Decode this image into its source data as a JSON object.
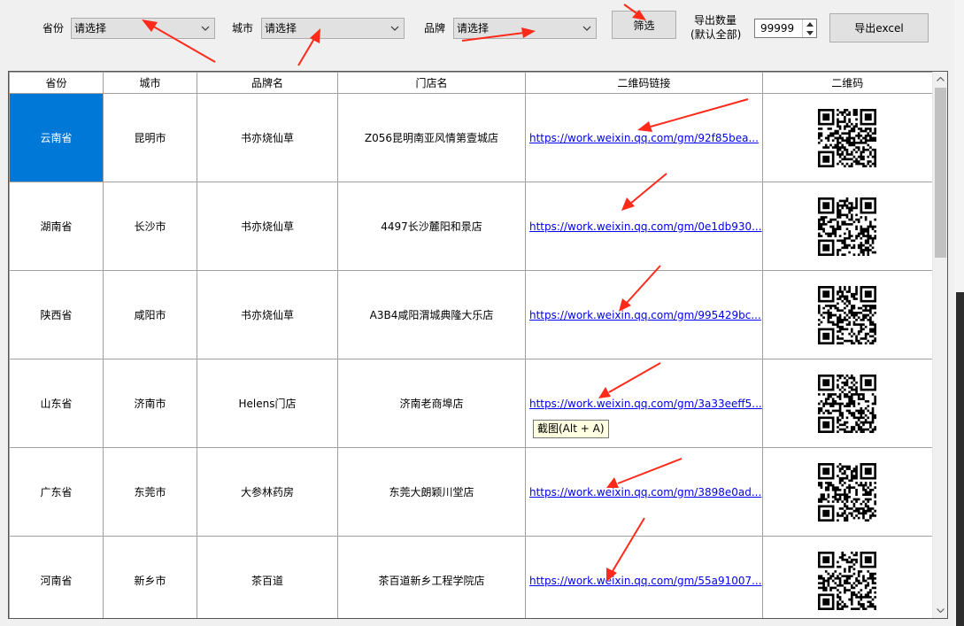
{
  "filters": {
    "province_label": "省份",
    "province_value": "请选择",
    "city_label": "城市",
    "city_value": "请选择",
    "brand_label": "品牌",
    "brand_value": "请选择",
    "filter_button": "筛选",
    "export_count_label_line1": "导出数量",
    "export_count_label_line2": "(默认全部)",
    "export_count_value": "99999",
    "export_button": "导出excel"
  },
  "table": {
    "headers": [
      "省份",
      "城市",
      "品牌名",
      "门店名",
      "二维码链接",
      "二维码"
    ],
    "rows": [
      {
        "province": "云南省",
        "city": "昆明市",
        "brand": "书亦烧仙草",
        "store": "Z056昆明南亚风情第壹城店",
        "link": "https://work.weixin.qq.com/gm/92f85bea..."
      },
      {
        "province": "湖南省",
        "city": "长沙市",
        "brand": "书亦烧仙草",
        "store": "4497长沙麓阳和景店",
        "link": "https://work.weixin.qq.com/gm/0e1db930..."
      },
      {
        "province": "陕西省",
        "city": "咸阳市",
        "brand": "书亦烧仙草",
        "store": "A3B4咸阳渭城典隆大乐店",
        "link": "https://work.weixin.qq.com/gm/995429bc..."
      },
      {
        "province": "山东省",
        "city": "济南市",
        "brand": "Helens门店",
        "store": "济南老商埠店",
        "link": "https://work.weixin.qq.com/gm/3a33eeff5..."
      },
      {
        "province": "广东省",
        "city": "东莞市",
        "brand": "大参林药房",
        "store": "东莞大朗颖川堂店",
        "link": "https://work.weixin.qq.com/gm/3898e0ad..."
      },
      {
        "province": "河南省",
        "city": "新乡市",
        "brand": "茶百道",
        "store": "茶百道新乡工程学院店",
        "link": "https://work.weixin.qq.com/gm/55a91007..."
      }
    ]
  },
  "tooltip": {
    "text": "截图(Alt + A)"
  },
  "icons": {
    "dropdown": "chevron-down-icon",
    "spin_up": "chevron-up-icon",
    "spin_down": "chevron-down-icon",
    "qr": "qr-code-icon",
    "annotation": "red-arrow-annotation"
  },
  "colors": {
    "selection": "#0078d7",
    "link": "#0000ee",
    "annotation": "#ff2a1a",
    "window_bg": "#f0f0f0",
    "tooltip_bg": "#ffffe1"
  }
}
